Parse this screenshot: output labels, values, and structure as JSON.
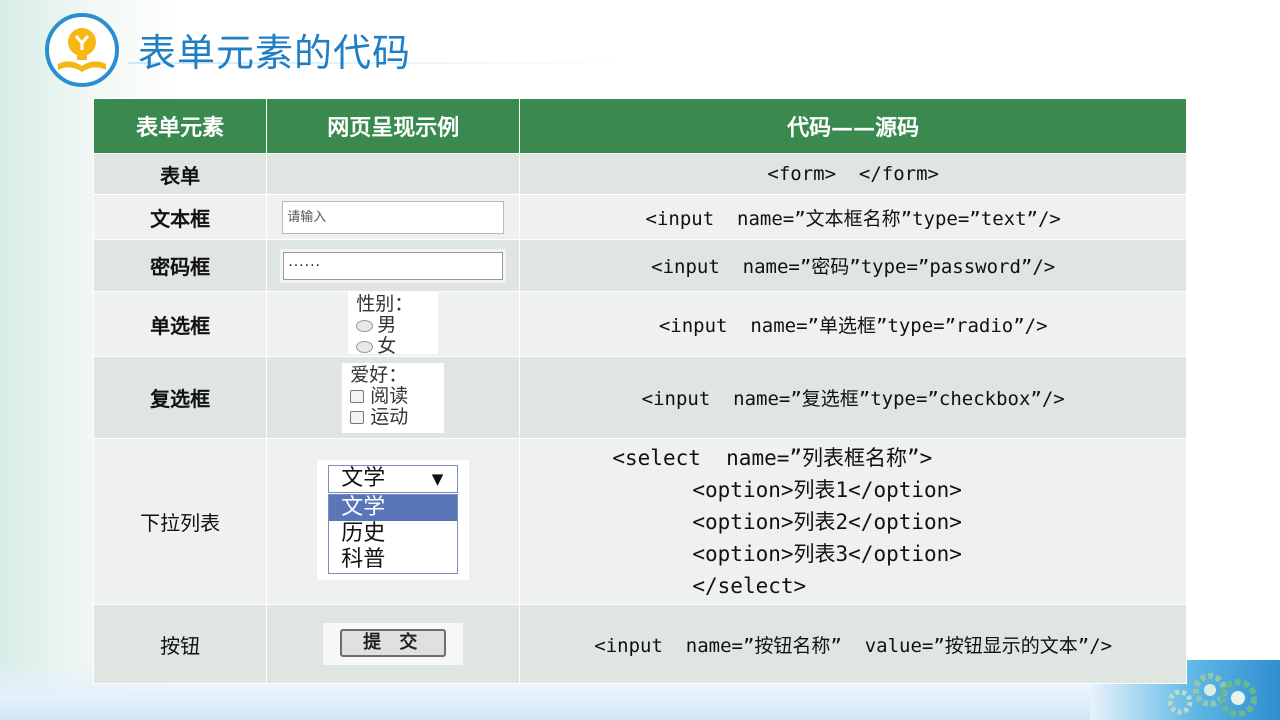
{
  "page": {
    "title": "表单元素的代码"
  },
  "table": {
    "headers": [
      "表单元素",
      "网页呈现示例",
      "代码——源码"
    ],
    "rows": [
      {
        "element": "表单",
        "code": "<form>  </form>"
      },
      {
        "element": "文本框",
        "code": "<input  name=”文本框名称”type=”text”/>",
        "demo_placeholder": "请输入"
      },
      {
        "element": "密码框",
        "code": "<input  name=”密码”type=”password”/>",
        "demo_value": "······"
      },
      {
        "element": "单选框",
        "code": "<input  name=”单选框”type=”radio”/>",
        "demo_label": "性别：",
        "demo_options": [
          "男",
          "女"
        ]
      },
      {
        "element": "复选框",
        "code": "<input  name=”复选框”type=”checkbox”/>",
        "demo_label": "爱好：",
        "demo_options": [
          "阅读",
          "运动"
        ]
      },
      {
        "element": "下拉列表",
        "code_lines": [
          "<select  name=”列表框名称”>",
          "<option>列表1</option>",
          "<option>列表2</option>",
          "<option>列表3</option>",
          "</select>"
        ],
        "demo_selected": "文学",
        "demo_options": [
          "文学",
          "历史",
          "科普"
        ]
      },
      {
        "element": "按钮",
        "code": "<input  name=”按钮名称”  value=”按钮显示的文本”/>",
        "demo_button": "提 交"
      }
    ]
  },
  "colors": {
    "header_bg": "#3a8a50",
    "title": "#1f7ec4",
    "row_odd": "#dfe5e1",
    "row_even": "#eef1ee"
  }
}
